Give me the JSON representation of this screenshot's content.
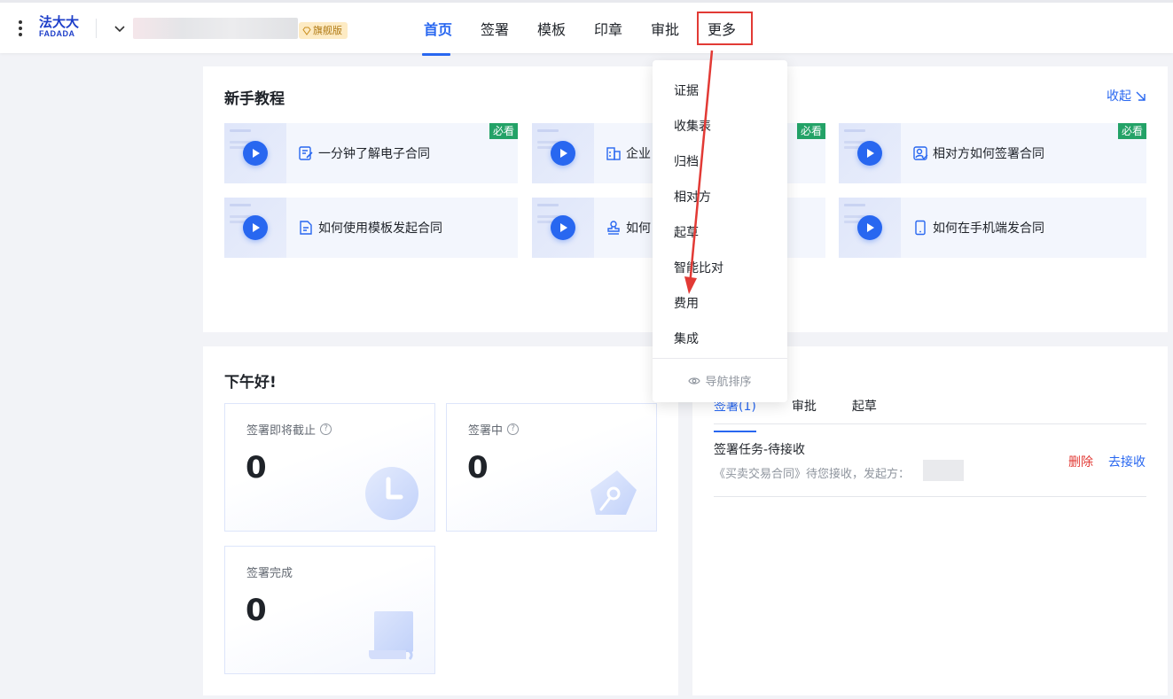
{
  "header": {
    "logo_cn": "法大大",
    "logo_en": "FADADA",
    "edition_badge": "旗舰版",
    "nav": [
      "首页",
      "签署",
      "模板",
      "印章",
      "审批",
      "更多"
    ]
  },
  "tutorial": {
    "title": "新手教程",
    "collapse": "收起",
    "badge": "必看",
    "cards": [
      {
        "label": "一分钟了解电子合同",
        "icon": "edit-doc-icon"
      },
      {
        "label": "企业",
        "icon": "building-icon"
      },
      {
        "label": "相对方如何签署合同",
        "icon": "user-check-icon"
      },
      {
        "label": "如何使用模板发起合同",
        "icon": "document-icon"
      },
      {
        "label": "如何",
        "icon": "stamp-icon"
      },
      {
        "label": "如何在手机端发合同",
        "icon": "phone-icon"
      }
    ]
  },
  "greeting": {
    "title": "下午好!",
    "stats": [
      {
        "label": "签署即将截止",
        "value": "0",
        "icon": "clock-icon"
      },
      {
        "label": "签署中",
        "value": "0",
        "icon": "pen-nib-icon"
      },
      {
        "label": "签署完成",
        "value": "0",
        "icon": "scroll-icon"
      }
    ]
  },
  "tasks": {
    "tabs": [
      "签署(1)",
      "审批",
      "起草"
    ],
    "item_title": "签署任务-待接收",
    "item_desc": "《买卖交易合同》待您接收，发起方：",
    "delete": "删除",
    "receive": "去接收"
  },
  "dropdown": {
    "items": [
      "证据",
      "收集表",
      "归档",
      "相对方",
      "起草",
      "智能比对",
      "费用",
      "集成"
    ],
    "footer": "导航排序"
  },
  "colors": {
    "primary": "#2867f0",
    "danger": "#e23a35",
    "badge_green": "#23a267",
    "highlight_box": "#e23a35"
  }
}
